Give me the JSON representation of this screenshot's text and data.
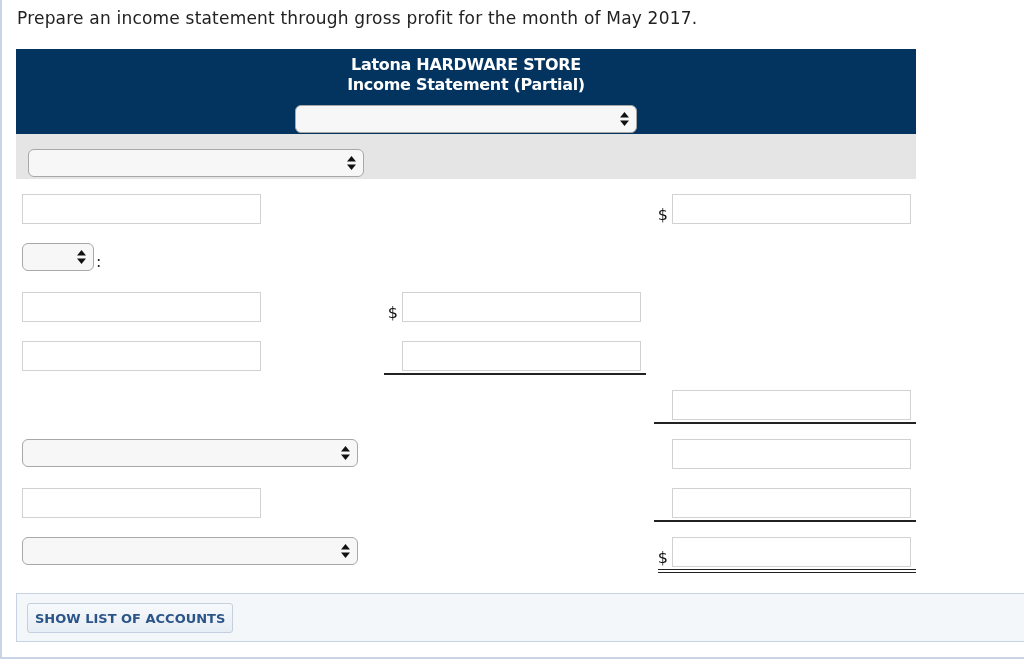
{
  "instruction": "Prepare an income statement through gross profit for the month of May 2017.",
  "statement": {
    "company": "Latona HARDWARE STORE",
    "title": "Income Statement (Partial)",
    "period_field": {
      "kind": "select"
    },
    "band": {
      "label": {
        "kind": "select"
      }
    },
    "rows": [
      {
        "label": {
          "kind": "input"
        },
        "column_3": {
          "kind": "input",
          "currency": "$",
          "underlined": false,
          "double": false
        }
      },
      {
        "label": {
          "kind": "short_select",
          "suffix": ":"
        }
      },
      {
        "label": {
          "kind": "input"
        },
        "column_2": {
          "kind": "input",
          "currency": "$",
          "underlined": false,
          "double": false
        }
      },
      {
        "label": {
          "kind": "input"
        },
        "column_2": {
          "kind": "input",
          "underlined": true,
          "double": false
        }
      },
      {
        "column_3": {
          "kind": "input",
          "underlined": true,
          "double": false
        }
      },
      {
        "label": {
          "kind": "select"
        },
        "column_3": {
          "kind": "input",
          "underlined": false,
          "double": false
        }
      },
      {
        "label": {
          "kind": "input"
        },
        "column_3": {
          "kind": "input",
          "underlined": true,
          "double": false
        }
      },
      {
        "label": {
          "kind": "select"
        },
        "column_3": {
          "kind": "input",
          "currency": "$",
          "underlined": true,
          "double": true
        }
      }
    ]
  },
  "footer": {
    "button": "SHOW LIST OF ACCOUNTS"
  }
}
